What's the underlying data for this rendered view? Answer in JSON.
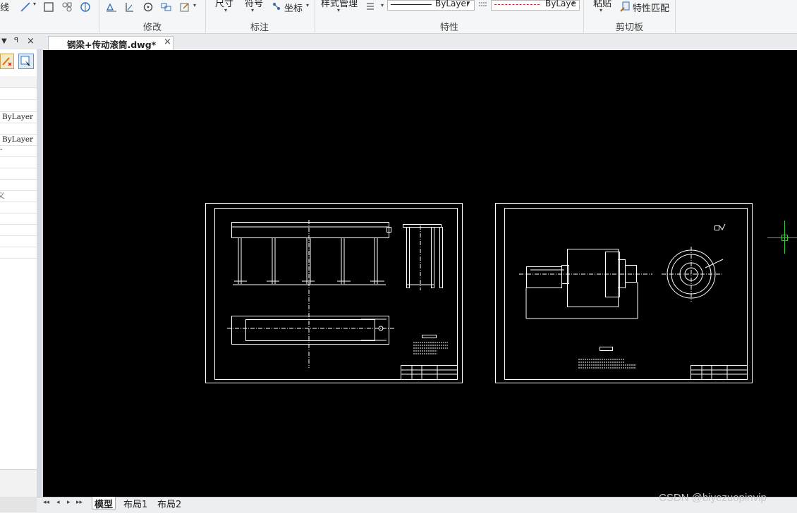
{
  "ribbon": {
    "items": {
      "line_style": "线",
      "dimension": "尺寸",
      "symbol": "符号",
      "coordinate": "坐标",
      "style_manager": "样式管理",
      "bylayer_1": "ByLayer",
      "bylayer_2": "ByLaye",
      "paste": "粘贴",
      "match_props": "特性匹配"
    },
    "groups": {
      "modify": "修改",
      "annotate": "标注",
      "properties": "特性",
      "clipboard": "剪切板"
    }
  },
  "document": {
    "tab_title": "钢梁+传动滚筒.dwg*",
    "close_glyph": "×"
  },
  "palette": {
    "header_glyphs": {
      "dropdown": "▼",
      "pin": "ꟼ",
      "close": "×"
    },
    "bylayer_a": "ByLayer",
    "bylayer_b": "ByLayer",
    "partial_char": "义",
    "dash": "-"
  },
  "layout_tabs": {
    "nav": [
      "◂◂",
      "◂",
      "▸",
      "▸▸"
    ],
    "model": "模型",
    "layout1": "布局1",
    "layout2": "布局2"
  },
  "watermark": "CSDN @biyezuopinvip",
  "colors": {
    "canvas": "#000000",
    "drawing_lines": "#ffffff",
    "cursor": "#33cc33"
  }
}
